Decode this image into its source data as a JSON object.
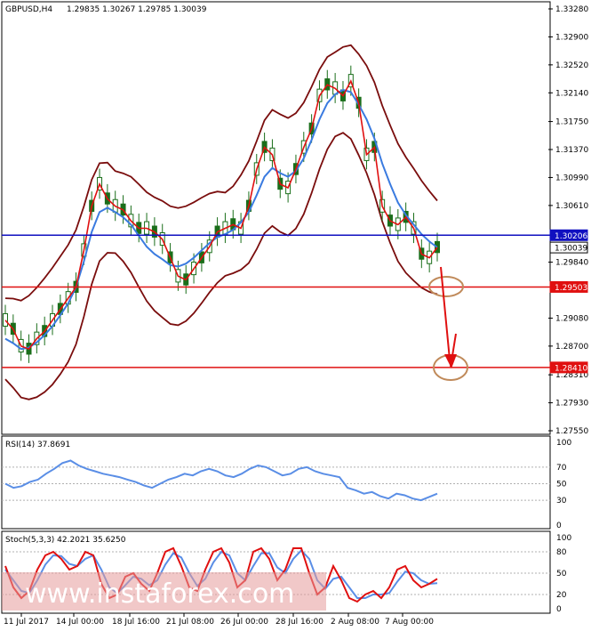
{
  "header": {
    "symbol": "GBPUSD,H4",
    "ohlc": "1.29835 1.30267 1.29785 1.30039"
  },
  "rsi_header": "RSI(14) 37.8691",
  "stoch_header": "Stoch(5,3,3) 42.2021 35.6250",
  "watermark": "www.instaforex.com",
  "x_labels": [
    "11 Jul 2017",
    "14 Jul 00:00",
    "18 Jul 16:00",
    "21 Jul 08:00",
    "26 Jul 00:00",
    "28 Jul 16:00",
    "2 Aug 08:00",
    "7 Aug 00:00"
  ],
  "colors": {
    "price_bands": "#7a0d0d",
    "fast_ma": "#e01010",
    "slow_ma": "#3a7be0",
    "candle": "#1a6e1a",
    "resistance_line": "#1010c0",
    "support_line": "#e01010",
    "rsi_line": "#5a8ee6",
    "stoch_main": "#e01010",
    "stoch_signal": "#5a8ee6",
    "ellipse": "#c08a5a",
    "arrow": "#e01010"
  },
  "chart_data": [
    {
      "type": "line",
      "name": "price",
      "y_ticks": [
        "1.33280",
        "1.32900",
        "1.32520",
        "1.32140",
        "1.31750",
        "1.31370",
        "1.30990",
        "1.30610",
        "1.29840",
        "1.29080",
        "1.28700",
        "1.28310",
        "1.27930",
        "1.27550"
      ],
      "ylim": [
        1.2755,
        1.3328
      ],
      "levels": [
        {
          "value": "1.30206",
          "kind": "resistance"
        },
        {
          "value": "1.30039",
          "kind": "current"
        },
        {
          "value": "1.29503",
          "kind": "support"
        },
        {
          "value": "1.28410",
          "kind": "support"
        }
      ],
      "series": [
        {
          "values": [
            1.2905,
            1.2893,
            1.287,
            1.2866,
            1.288,
            1.289,
            1.2905,
            1.292,
            1.2935,
            1.295,
            1.3,
            1.306,
            1.309,
            1.307,
            1.306,
            1.3055,
            1.304,
            1.303,
            1.303,
            1.3025,
            1.3015,
            1.299,
            1.2965,
            1.296,
            1.2975,
            1.299,
            1.3005,
            1.3025,
            1.303,
            1.3035,
            1.303,
            1.306,
            1.311,
            1.314,
            1.313,
            1.309,
            1.3085,
            1.311,
            1.314,
            1.3165,
            1.321,
            1.3225,
            1.322,
            1.321,
            1.323,
            1.32,
            1.313,
            1.314,
            1.306,
            1.304,
            1.3035,
            1.3045,
            1.303,
            1.2995,
            1.299,
            1.3004
          ]
        },
        {
          "values": [
            1.288,
            1.2874,
            1.2866,
            1.2868,
            1.2875,
            1.2885,
            1.2897,
            1.2912,
            1.2928,
            1.295,
            1.2985,
            1.3025,
            1.3052,
            1.3058,
            1.3052,
            1.3045,
            1.3035,
            1.302,
            1.3005,
            1.2995,
            1.2988,
            1.298,
            1.2978,
            1.2982,
            1.299,
            1.3,
            1.301,
            1.3018,
            1.3022,
            1.3028,
            1.3038,
            1.3052,
            1.3075,
            1.31,
            1.3112,
            1.3105,
            1.31,
            1.3108,
            1.3125,
            1.315,
            1.3178,
            1.32,
            1.3212,
            1.3218,
            1.3215,
            1.3198,
            1.3178,
            1.3152,
            1.3118,
            1.309,
            1.3065,
            1.3048,
            1.3035,
            1.3022,
            1.3012,
            1.3004
          ]
        }
      ]
    },
    {
      "type": "line",
      "name": "RSI(14)",
      "y_ticks": [
        "100",
        "70",
        "50",
        "30",
        "0"
      ],
      "ylim": [
        0,
        100
      ],
      "values": [
        50,
        45,
        47,
        52,
        55,
        62,
        68,
        75,
        78,
        72,
        68,
        65,
        62,
        60,
        58,
        55,
        52,
        48,
        45,
        50,
        55,
        58,
        62,
        60,
        65,
        68,
        65,
        60,
        58,
        62,
        68,
        72,
        70,
        65,
        60,
        62,
        68,
        70,
        65,
        62,
        60,
        58,
        45,
        42,
        38,
        40,
        35,
        32,
        38,
        36,
        32,
        30,
        34,
        38
      ]
    },
    {
      "type": "line",
      "name": "Stoch(5,3,3)",
      "y_ticks": [
        "100",
        "80",
        "50",
        "20",
        "0"
      ],
      "ylim": [
        0,
        100
      ],
      "series": [
        {
          "values": [
            60,
            30,
            15,
            25,
            55,
            75,
            80,
            70,
            55,
            60,
            80,
            75,
            35,
            15,
            20,
            45,
            50,
            35,
            25,
            50,
            80,
            85,
            60,
            30,
            25,
            55,
            80,
            85,
            65,
            30,
            40,
            80,
            85,
            70,
            40,
            55,
            85,
            85,
            50,
            20,
            30,
            60,
            40,
            15,
            10,
            20,
            25,
            15,
            30,
            55,
            60,
            40,
            30,
            35,
            42
          ]
        },
        {
          "values": [
            55,
            40,
            25,
            22,
            40,
            62,
            75,
            74,
            63,
            60,
            70,
            75,
            55,
            30,
            22,
            33,
            45,
            42,
            33,
            40,
            62,
            78,
            72,
            50,
            32,
            42,
            65,
            80,
            75,
            50,
            40,
            60,
            78,
            78,
            58,
            50,
            70,
            82,
            70,
            40,
            28,
            42,
            45,
            30,
            15,
            15,
            20,
            20,
            22,
            38,
            52,
            50,
            40,
            35,
            36
          ]
        }
      ]
    }
  ]
}
